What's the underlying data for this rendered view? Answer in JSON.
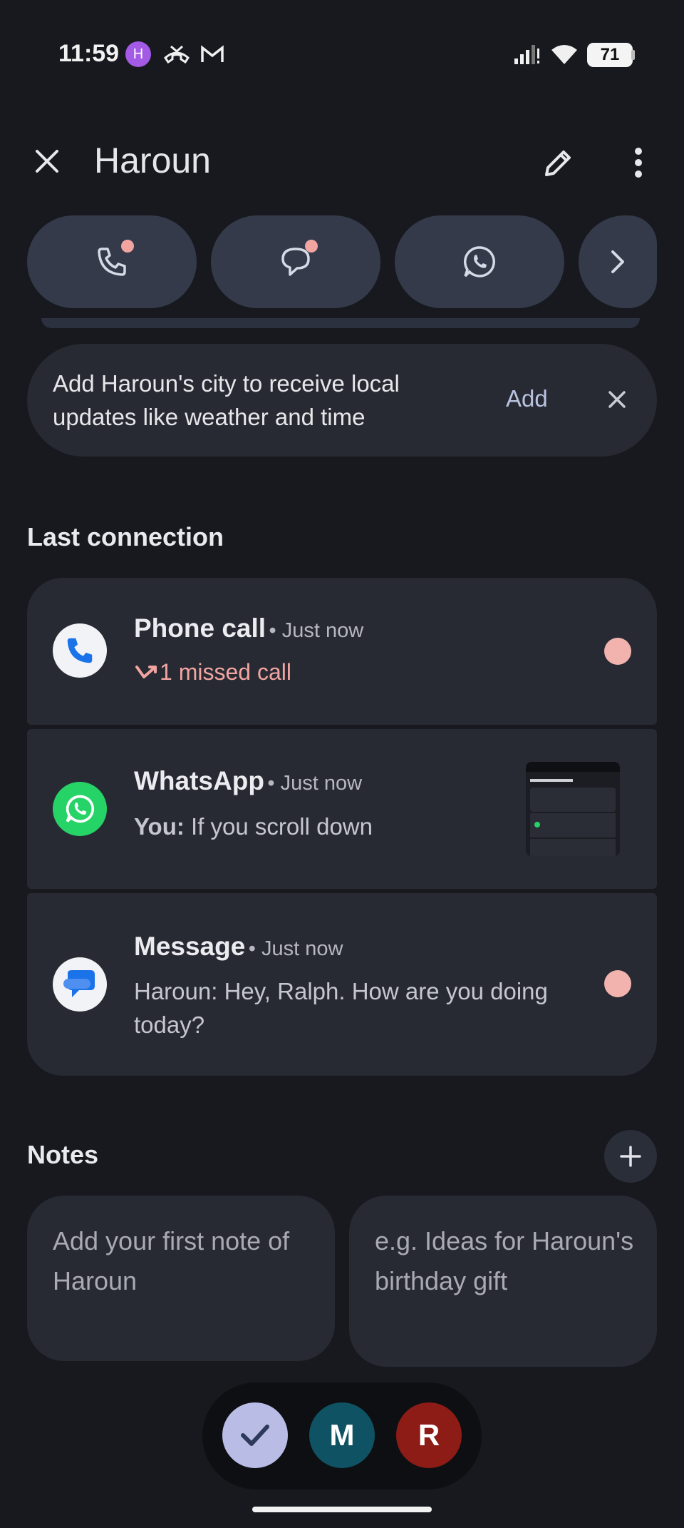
{
  "status_bar": {
    "time": "11:59",
    "avatar_letter": "H",
    "battery": "71"
  },
  "header": {
    "title": "Haroun"
  },
  "suggestion": {
    "text": "Add Haroun's city to receive local updates like weather and time",
    "add_label": "Add"
  },
  "last_connection": {
    "title": "Last connection",
    "items": [
      {
        "app": "Phone call",
        "time": "• Just now",
        "detail": "1 missed call",
        "unread": true
      },
      {
        "app": "WhatsApp",
        "time": "• Just now",
        "sender": "You:",
        "detail": "If you scroll down",
        "unread": false
      },
      {
        "app": "Message",
        "time": "• Just now",
        "detail": "Haroun: Hey, Ralph. How are you doing today?",
        "unread": true
      }
    ]
  },
  "notes": {
    "title": "Notes",
    "cards": [
      {
        "placeholder": "Add your first note of Haroun"
      },
      {
        "placeholder": "e.g. Ideas for Haroun's birthday gift"
      }
    ]
  },
  "bubbles": [
    {
      "label": "",
      "icon": "check-icon",
      "color": "#b9bde6"
    },
    {
      "label": "M",
      "color": "#0f5264"
    },
    {
      "label": "R",
      "color": "#8d1c17"
    }
  ],
  "colors": {
    "background": "#17191e",
    "card": "#272a33",
    "pill": "#343a4a",
    "unread_dot": "#f2a5a0",
    "missed": "#f2a5a0",
    "whatsapp": "#25d366",
    "messages_blue": "#1a73e8"
  }
}
